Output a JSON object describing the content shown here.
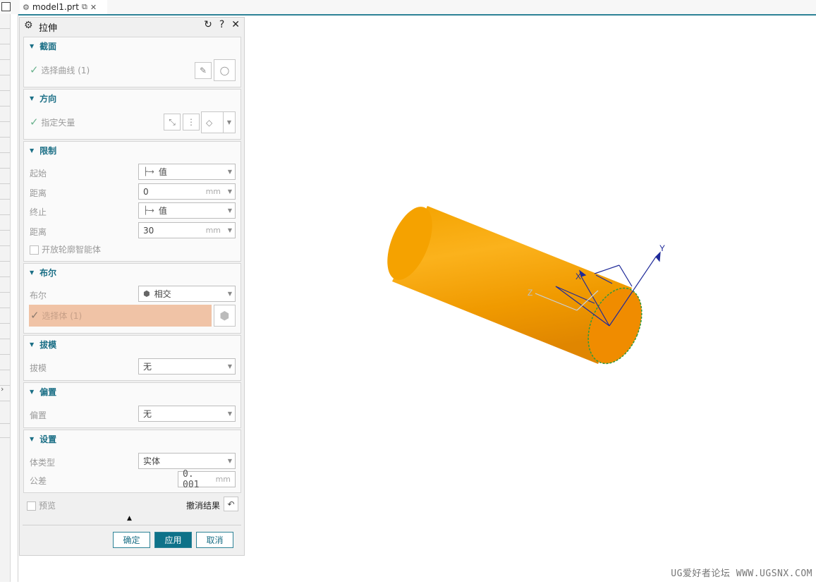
{
  "tab": {
    "filename": "model1.prt"
  },
  "dialog": {
    "title": "拉伸",
    "sections": {
      "section": {
        "label": "截面",
        "select_curve": "选择曲线 (1)"
      },
      "direction": {
        "label": "方向",
        "specify_vector": "指定矢量"
      },
      "limits": {
        "label": "限制",
        "start_label": "起始",
        "start_value": "值",
        "start_distance_label": "距离",
        "start_distance_value": "0",
        "start_distance_unit": "mm",
        "end_label": "终止",
        "end_value": "值",
        "end_distance_label": "距离",
        "end_distance_value": "30",
        "end_distance_unit": "mm",
        "open_profile": "开放轮廓智能体"
      },
      "boolean": {
        "label": "布尔",
        "bool_label": "布尔",
        "bool_value": "相交",
        "select_body": "选择体 (1)"
      },
      "draft": {
        "label": "拔模",
        "draft_label": "拔模",
        "draft_value": "无"
      },
      "offset": {
        "label": "偏置",
        "offset_label": "偏置",
        "offset_value": "无"
      },
      "settings": {
        "label": "设置",
        "body_type_label": "体类型",
        "body_type_value": "实体",
        "tolerance_label": "公差",
        "tolerance_value": "0. 001",
        "tolerance_unit": "mm"
      }
    },
    "preview_label": "预览",
    "undo_result_label": "撤消结果",
    "buttons": {
      "ok": "确定",
      "apply": "应用",
      "cancel": "取消"
    }
  },
  "viewport": {
    "axis_x": "X",
    "axis_y": "Y",
    "axis_z": "Z",
    "cylinder_color": "#f59c00"
  },
  "watermark": "UG爱好者论坛 WWW.UGSNX.COM"
}
